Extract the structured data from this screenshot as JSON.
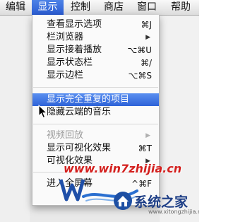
{
  "menubar": {
    "items": [
      {
        "label": "编辑"
      },
      {
        "label": "显示"
      },
      {
        "label": "控制"
      },
      {
        "label": "商店"
      },
      {
        "label": "窗口"
      },
      {
        "label": "帮助"
      }
    ],
    "active_index": 1
  },
  "view_menu": {
    "items": [
      {
        "label": "查看显示选项",
        "shortcut": "⌘J",
        "submenu": false,
        "enabled": true,
        "highlighted": false
      },
      {
        "label": "栏浏览器",
        "shortcut": "",
        "submenu": true,
        "enabled": true,
        "highlighted": false
      },
      {
        "label": "显示接着播放",
        "shortcut": "⌥⌘U",
        "submenu": false,
        "enabled": true,
        "highlighted": false
      },
      {
        "label": "显示状态栏",
        "shortcut": "⌘/",
        "submenu": false,
        "enabled": true,
        "highlighted": false
      },
      {
        "label": "显示边栏",
        "shortcut": "⌥⌘S",
        "submenu": false,
        "enabled": true,
        "highlighted": false
      },
      {
        "label": "显示完全重复的项目",
        "shortcut": "",
        "submenu": false,
        "enabled": true,
        "highlighted": true
      },
      {
        "label": "隐藏云端的音乐",
        "shortcut": "",
        "submenu": false,
        "enabled": true,
        "highlighted": false
      },
      {
        "label": "视频回放",
        "shortcut": "",
        "submenu": true,
        "enabled": false,
        "highlighted": false
      },
      {
        "label": "显示可视化效果",
        "shortcut": "⌘T",
        "submenu": false,
        "enabled": true,
        "highlighted": false
      },
      {
        "label": "可视化效果",
        "shortcut": "",
        "submenu": true,
        "enabled": true,
        "highlighted": false
      },
      {
        "label": "进入全屏幕",
        "shortcut": "^⌘F",
        "submenu": false,
        "enabled": true,
        "highlighted": false
      }
    ],
    "submenu_arrow": "▶"
  },
  "watermark": {
    "site": "www.win7zhijia.cn",
    "brand": "系统之家",
    "brand_sub": "www.xitongzhijia.net"
  },
  "colors": {
    "highlight": "#2e63d8",
    "watermark_red": "#d3201e",
    "watermark_blue": "#1d3e86"
  },
  "icons": {
    "cursor": "arrow-cursor-icon",
    "submenu": "triangle-right-icon",
    "logo": "win7-logo-icon"
  }
}
